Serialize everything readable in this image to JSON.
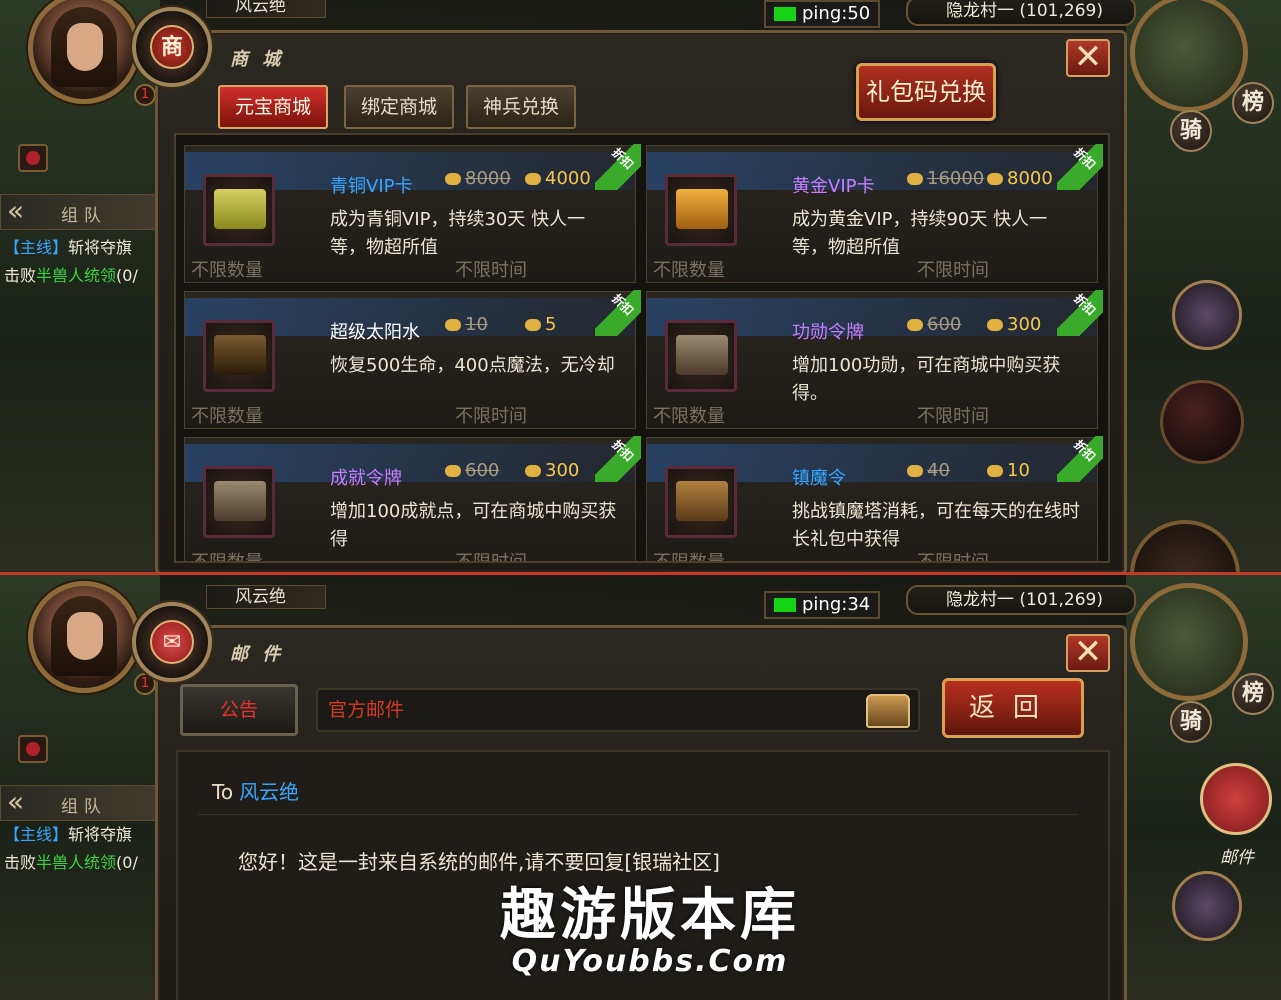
{
  "top": {
    "player_name": "风云绝",
    "ping": "ping:50",
    "location": "隐龙村一 (101,269)",
    "panel_title": "商 城",
    "emblem_char": "商",
    "tabs": [
      "元宝商城",
      "绑定商城",
      "神兵兑换"
    ],
    "active_tab": 0,
    "gift_button": "礼包码兑换",
    "items": [
      {
        "name": "青铜VIP卡",
        "name_color": "#38a6ff",
        "old_price": "8000",
        "new_price": "4000",
        "desc": "成为青铜VIP，持续30天 快人一等，物超所值",
        "quantity": "不限数量",
        "time": "不限时间",
        "ribbon": "折扣",
        "icon": "bronze-vip-card-icon"
      },
      {
        "name": "黄金VIP卡",
        "name_color": "#c77dff",
        "old_price": "16000",
        "new_price": "8000",
        "desc": "成为黄金VIP，持续90天 快人一等，物超所值",
        "quantity": "不限数量",
        "time": "不限时间",
        "ribbon": "折扣",
        "icon": "gold-vip-card-icon"
      },
      {
        "name": "超级太阳水",
        "name_color": "#ffffff",
        "old_price": "10",
        "new_price": "5",
        "desc": "恢复500生命，400点魔法，无冷却",
        "quantity": "不限数量",
        "time": "不限时间",
        "ribbon": "折扣",
        "icon": "sun-water-icon"
      },
      {
        "name": "功勋令牌",
        "name_color": "#c77dff",
        "old_price": "600",
        "new_price": "300",
        "desc": "增加100功勋，可在商城中购买获得。",
        "quantity": "不限数量",
        "time": "不限时间",
        "ribbon": "折扣",
        "icon": "merit-token-icon"
      },
      {
        "name": "成就令牌",
        "name_color": "#c77dff",
        "old_price": "600",
        "new_price": "300",
        "desc": "增加100成就点，可在商城中购买获得",
        "quantity": "不限数量",
        "time": "不限时间",
        "ribbon": "折扣",
        "icon": "achievement-token-icon"
      },
      {
        "name": "镇魔令",
        "name_color": "#38a6ff",
        "old_price": "40",
        "new_price": "10",
        "desc": "挑战镇魔塔消耗，可在每天的在线时长礼包中获得",
        "quantity": "不限数量",
        "time": "不限时间",
        "ribbon": "折扣",
        "icon": "demon-seal-icon"
      }
    ]
  },
  "bottom": {
    "player_name": "风云绝",
    "ping": "ping:34",
    "location": "隐龙村一 (101,269)",
    "panel_title": "邮 件",
    "notice_tab": "公告",
    "mail_subject": "官方邮件",
    "back_button": "返回",
    "to_label": "To",
    "to_name": "风云绝",
    "mail_text": "您好！这是一封来自系统的邮件,请不要回复[银瑞社区]",
    "mail_side_label": "邮件"
  },
  "side": {
    "team_label": "组队",
    "quest_tag": "【主线】",
    "quest_name": "斩将夺旗",
    "quest_prefix": "击败",
    "quest_target": "半兽人统领",
    "quest_count": "(0/",
    "level_badge": "1",
    "rank_button": "榜",
    "ride_button": "骑"
  },
  "watermark": {
    "cn": "趣游版本库",
    "en": "QuYoubbs.Com"
  },
  "colors": {
    "accent_red": "#c23a2a",
    "gold": "#f4c84a",
    "ping_green": "#16d316",
    "link_blue": "#38a6ff"
  }
}
